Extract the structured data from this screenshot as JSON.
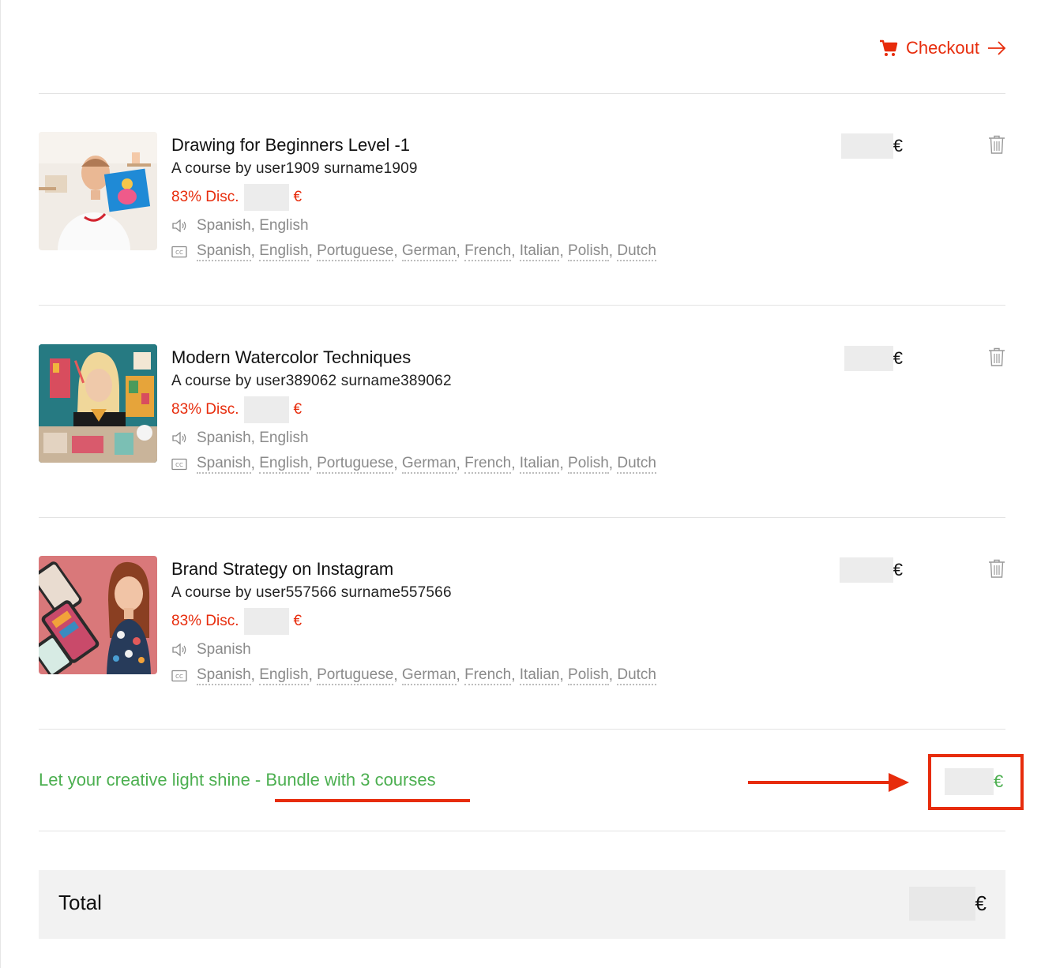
{
  "header": {
    "checkout_label": "Checkout"
  },
  "courses": [
    {
      "title": "Drawing for Beginners Level -1",
      "author": "A course by user1909 surname1909",
      "discount": "83% Disc.",
      "currency": "€",
      "audio": "Spanish, English",
      "subtitles": [
        "Spanish",
        "English",
        "Portuguese",
        "German",
        "French",
        "Italian",
        "Polish",
        "Dutch"
      ]
    },
    {
      "title": "Modern Watercolor Techniques",
      "author": "A course by user389062 surname389062",
      "discount": "83% Disc.",
      "currency": "€",
      "audio": "Spanish, English",
      "subtitles": [
        "Spanish",
        "English",
        "Portuguese",
        "German",
        "French",
        "Italian",
        "Polish",
        "Dutch"
      ]
    },
    {
      "title": "Brand Strategy on Instagram",
      "author": "A course by user557566 surname557566",
      "discount": "83% Disc.",
      "currency": "€",
      "audio": "Spanish",
      "subtitles": [
        "Spanish",
        "English",
        "Portuguese",
        "German",
        "French",
        "Italian",
        "Polish",
        "Dutch"
      ]
    }
  ],
  "bundle": {
    "label": "Let your creative light shine - Bundle with 3 courses",
    "currency": "€"
  },
  "total": {
    "label": "Total",
    "currency": "€"
  },
  "colors": {
    "accent": "#e72c0c",
    "bundle": "#4caf50",
    "muted": "#8a8a8a"
  }
}
